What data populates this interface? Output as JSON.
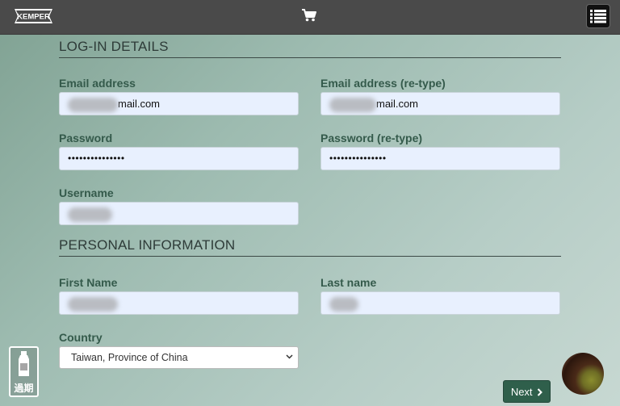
{
  "brand": {
    "logo_text": "KEMPER"
  },
  "header": {
    "cart_icon": "cart-icon",
    "menu_icon": "list-menu-icon"
  },
  "sections": {
    "login_title": "LOG-IN DETAILS",
    "personal_title": "PERSONAL INFORMATION"
  },
  "fields": {
    "email": {
      "label": "Email address",
      "value_suffix": "mail.com"
    },
    "email_retype": {
      "label": "Email address (re-type)",
      "value_suffix": "mail.com"
    },
    "password": {
      "label": "Password",
      "value": "•••••••••••••••"
    },
    "password_retype": {
      "label": "Password (re-type)",
      "value": "•••••••••••••••"
    },
    "username": {
      "label": "Username"
    },
    "first_name": {
      "label": "First Name"
    },
    "last_name": {
      "label": "Last name"
    },
    "country": {
      "label": "Country",
      "selected": "Taiwan, Province of China"
    }
  },
  "buttons": {
    "next_label": "Next"
  },
  "badge": {
    "text": "過期"
  }
}
